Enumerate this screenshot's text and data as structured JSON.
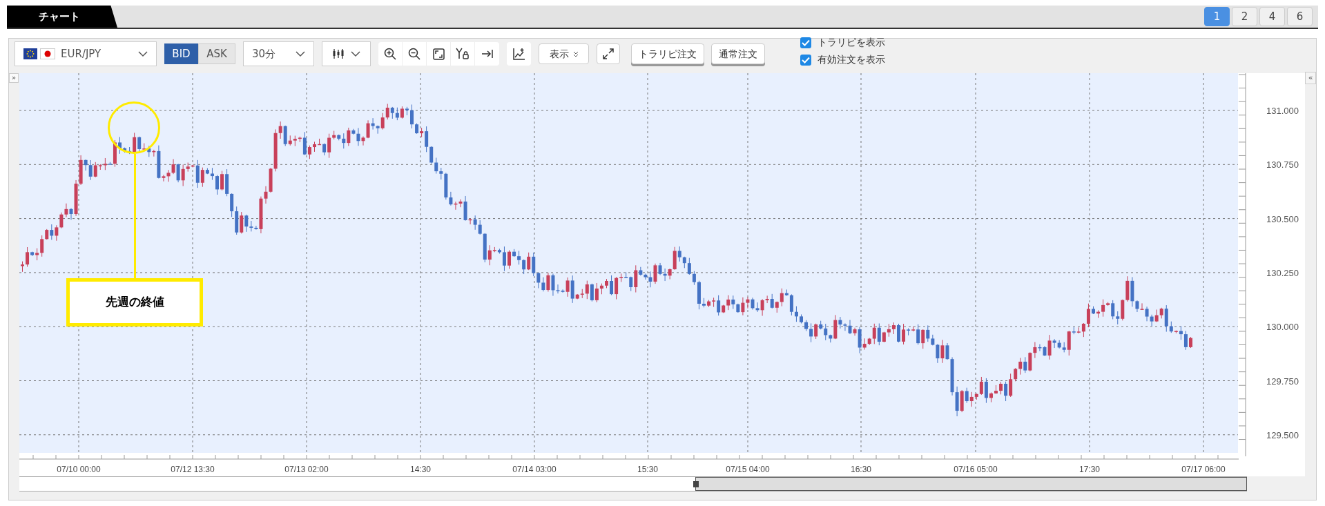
{
  "tab": {
    "label": "チャート"
  },
  "layout_buttons": [
    {
      "label": "1",
      "selected": true
    },
    {
      "label": "2",
      "selected": false
    },
    {
      "label": "4",
      "selected": false
    },
    {
      "label": "6",
      "selected": false
    }
  ],
  "toolbar": {
    "pair": {
      "value": "EUR/JPY"
    },
    "price_side": [
      {
        "label": "BID",
        "selected": true
      },
      {
        "label": "ASK",
        "selected": false
      }
    ],
    "interval": {
      "value": "30分"
    },
    "display_button": "表示",
    "order_buttons": [
      "トラリピ注文",
      "通常注文"
    ],
    "checkboxes": [
      {
        "label": "トラリピを表示",
        "checked": true
      },
      {
        "label": "有効注文を表示",
        "checked": true
      }
    ]
  },
  "left_toggle": "»",
  "right_toggle": "«",
  "chart": {
    "y_labels": [
      "131.000",
      "130.750",
      "130.500",
      "130.250",
      "130.000",
      "129.750",
      "129.500"
    ],
    "x_labels": [
      "07/10 00:00",
      "07/12 13:30",
      "07/13 02:00",
      "14:30",
      "07/14 03:00",
      "15:30",
      "07/15 04:00",
      "16:30",
      "07/16 05:00",
      "17:30",
      "07/17 06:00"
    ],
    "annotation": "先週の終値"
  }
}
